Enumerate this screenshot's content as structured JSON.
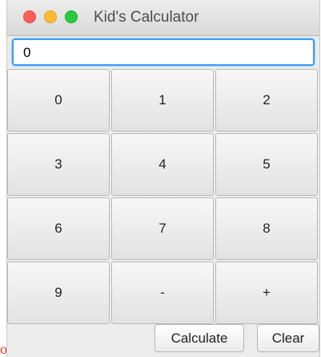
{
  "window": {
    "title": "Kid's Calculator"
  },
  "display": {
    "value": "0"
  },
  "keypad": {
    "keys": [
      "0",
      "1",
      "2",
      "3",
      "4",
      "5",
      "6",
      "7",
      "8",
      "9",
      "-",
      "+"
    ]
  },
  "actions": {
    "calculate_label": "Calculate",
    "clear_label": "Clear"
  },
  "background_text": "or {",
  "colors": {
    "close": "#fc5f57",
    "minimize": "#fdbc2e",
    "maximize": "#28c940",
    "focus_ring": "#3c9ff0",
    "stray_text": "#e8341a"
  }
}
